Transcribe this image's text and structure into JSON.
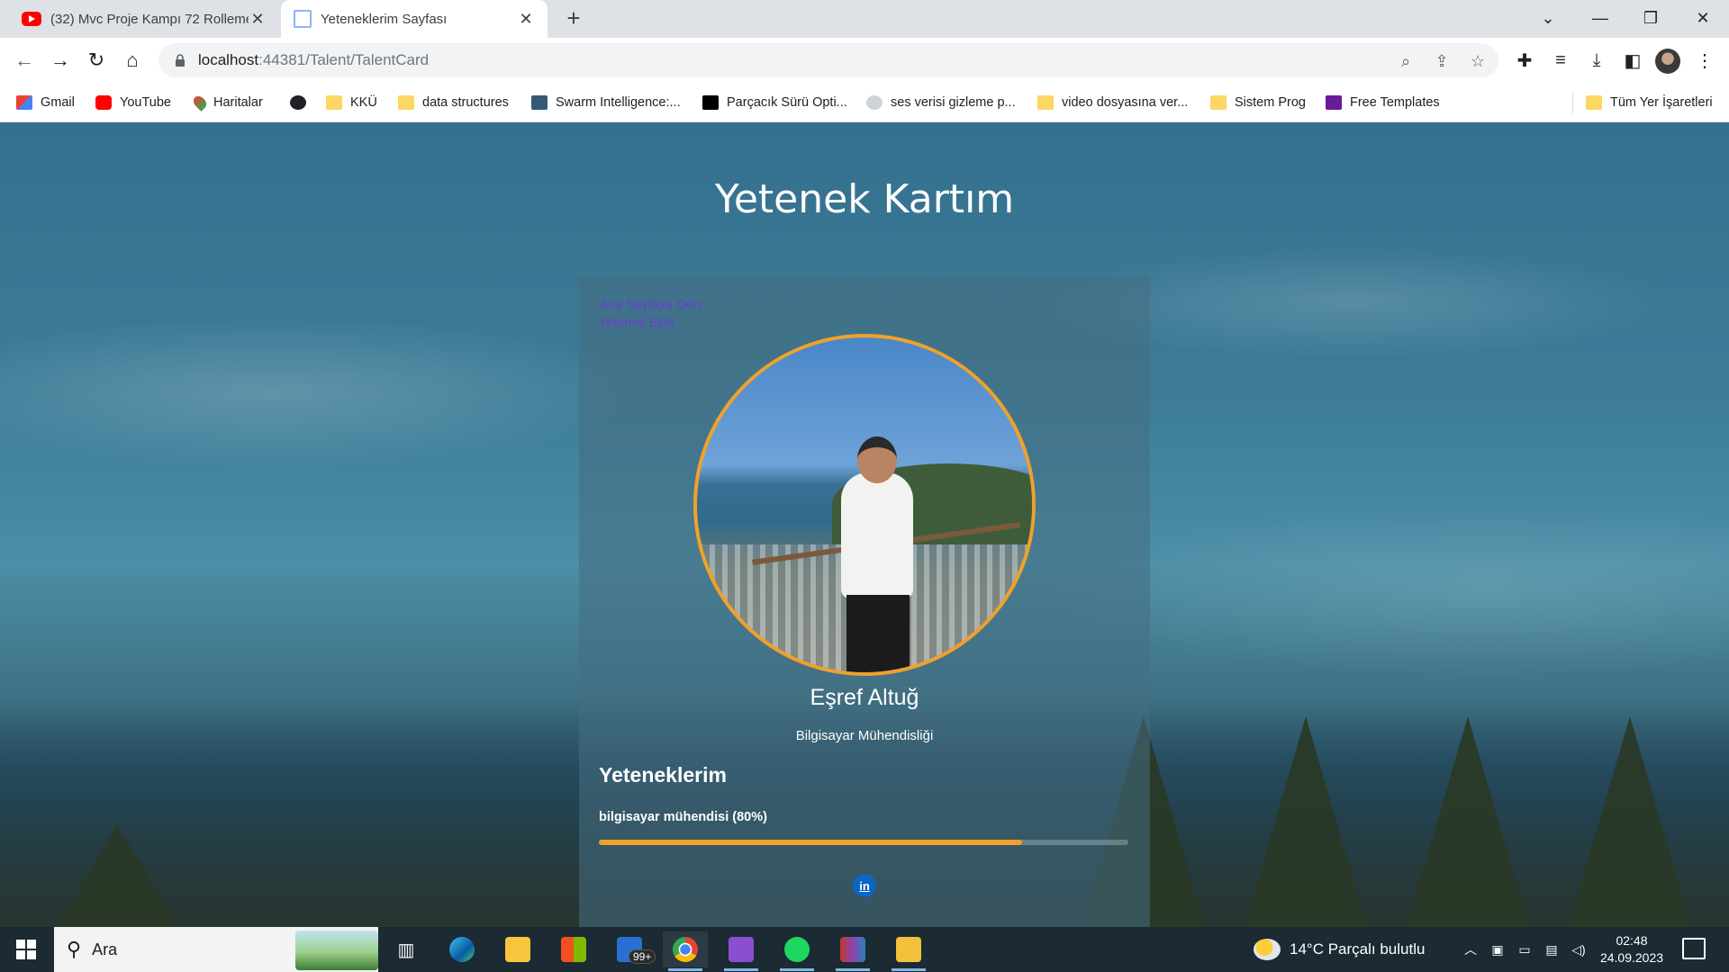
{
  "browser": {
    "tabs": [
      {
        "title": "(32) Mvc Proje Kampı 72 Rolleme",
        "favicon": "youtube-icon",
        "active": false
      },
      {
        "title": "Yeteneklerim Sayfası",
        "favicon": "document-icon",
        "active": true
      }
    ],
    "new_tab_symbol": "+",
    "url_host": "localhost",
    "url_rest": ":44381/Talent/TalentCard",
    "bookmarks": [
      {
        "label": "Gmail",
        "icon": "gmail-icon"
      },
      {
        "label": "YouTube",
        "icon": "youtube-icon"
      },
      {
        "label": "Haritalar",
        "icon": "maps-icon"
      },
      {
        "label": "",
        "icon": "globe-icon"
      },
      {
        "label": "KKÜ",
        "icon": "folder-icon"
      },
      {
        "label": "data structures",
        "icon": "folder-icon"
      },
      {
        "label": "Swarm Intelligence:...",
        "icon": "tds-icon"
      },
      {
        "label": "Parçacık Sürü Opti...",
        "icon": "medium-icon"
      },
      {
        "label": "ses verisi gizleme p...",
        "icon": "github-icon"
      },
      {
        "label": "video dosyasına ver...",
        "icon": "folder-icon"
      },
      {
        "label": "Sistem Prog",
        "icon": "folder-icon"
      },
      {
        "label": "Free Templates",
        "icon": "colorlib-icon"
      }
    ],
    "all_bookmarks": "Tüm Yer İşaretleri"
  },
  "page": {
    "title": "Yetenek Kartım",
    "links": [
      "Ana Sayfaya Dön",
      "Yetenek Ekle"
    ],
    "person_name": "Eşref Altuğ",
    "department": "Bilgisayar Mühendisliği",
    "skills_heading": "Yeteneklerim",
    "skills": [
      {
        "label": "bilgisayar mühendisi (80%)",
        "level": 0.8
      }
    ],
    "social": {
      "label": "in",
      "icon": "linkedin-icon"
    }
  },
  "taskbar": {
    "search_placeholder": "Ara",
    "mail_badge": "99+",
    "weather": "14°C  Parçalı bulutlu",
    "time": "02:48",
    "date": "24.09.2023"
  },
  "colors": {
    "accent_orange": "#f0a12c",
    "link_purple": "#6a3fd1",
    "linkedin_blue": "#0a66c2"
  }
}
